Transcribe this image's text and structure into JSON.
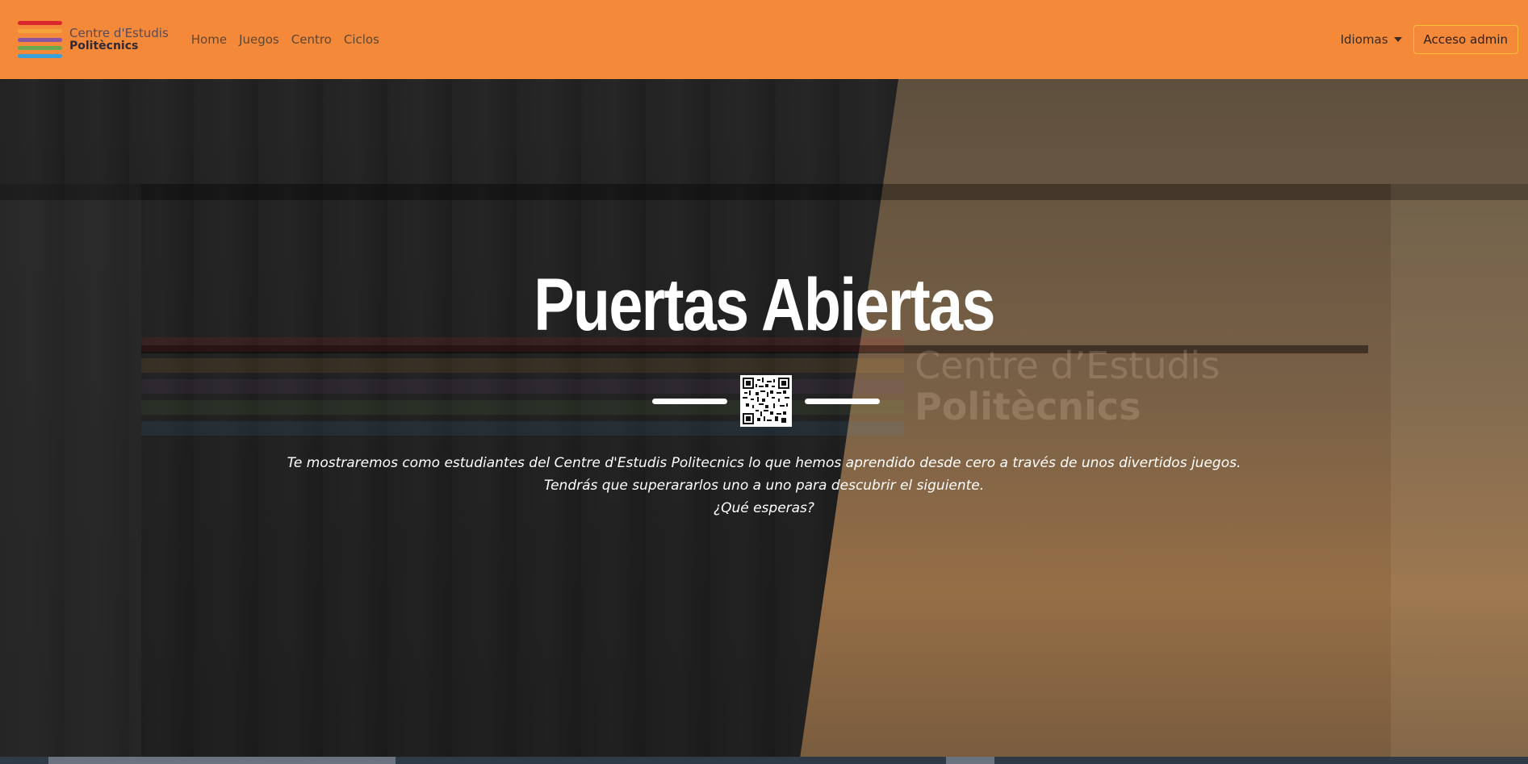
{
  "navbar": {
    "brand": {
      "line1": "Centre d'Estudis",
      "line2": "Politècnics",
      "logo_colors": [
        "#d9262c",
        "#f4a23a",
        "#8a55a4",
        "#6aa84f",
        "#3aa0d8"
      ]
    },
    "links": [
      {
        "label": "Home"
      },
      {
        "label": "Juegos"
      },
      {
        "label": "Centro"
      },
      {
        "label": "Ciclos"
      }
    ],
    "language_label": "Idiomas",
    "admin_button_label": "Acceso admin",
    "background_color": "#f4893a"
  },
  "hero": {
    "title": "Puertas Abiertas",
    "background_overlay": "dark",
    "qr_icon": "qr-code-icon",
    "ghost_logo": {
      "line1": "Centre d’Estudis",
      "line2": "Politècnics"
    },
    "text_lines": [
      "Te mostraremos como estudiantes del Centre d'Estudis Politecnics lo que hemos aprendido desde cero a través de unos divertidos juegos.",
      "Tendrás que superararlos uno a uno para descubrir el siguiente.",
      "¿Qué esperas?"
    ]
  }
}
